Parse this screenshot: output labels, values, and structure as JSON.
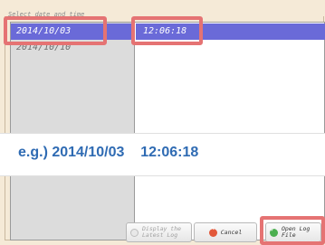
{
  "group": {
    "legend": "Select date and time"
  },
  "dates": {
    "items": [
      "2014/10/03",
      "2014/10/10"
    ],
    "selected": "2014/10/03"
  },
  "times": {
    "items": [
      "12:06:18"
    ],
    "selected": "12:06:18"
  },
  "callout": {
    "text": "e.g.) 2014/10/03    12:06:18"
  },
  "buttons": {
    "display_latest": "Display the\nLatest Log",
    "cancel": "Cancel",
    "open_log": "Open Log\nFile"
  },
  "icons": {
    "display_latest": "refresh-icon",
    "cancel": "cancel-icon",
    "open_log": "check-icon"
  },
  "colors": {
    "selection": "#6a6ad8",
    "highlight": "#e57373",
    "callout_text": "#2f6bb3",
    "background": "#f5ead7"
  }
}
